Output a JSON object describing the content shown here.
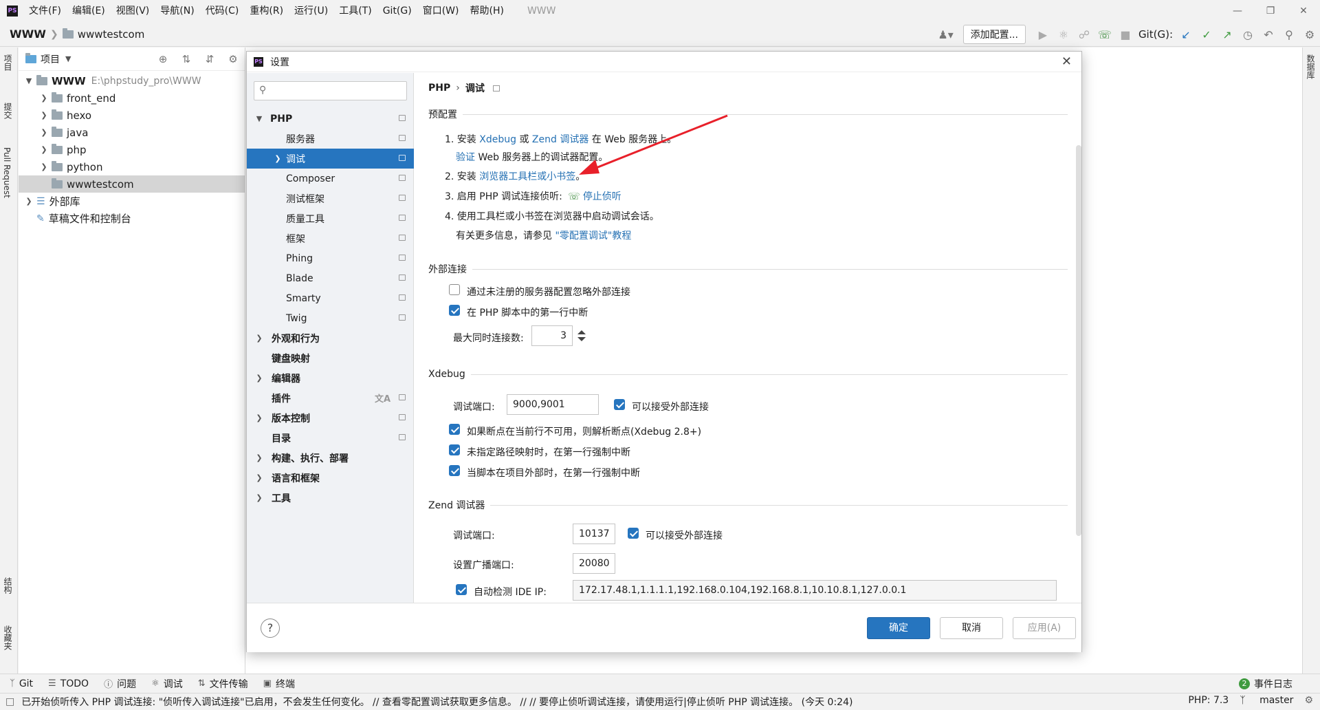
{
  "menubar": {
    "logo": "PS",
    "items": [
      "文件(F)",
      "编辑(E)",
      "视图(V)",
      "导航(N)",
      "代码(C)",
      "重构(R)",
      "运行(U)",
      "工具(T)",
      "Git(G)",
      "窗口(W)",
      "帮助(H)"
    ],
    "window_title": "WWW"
  },
  "navbar": {
    "root": "WWW",
    "leaf": "wwwtestcom",
    "add_config": "添加配置...",
    "git_label": "Git(G):"
  },
  "side_tabs": {
    "project": "项目",
    "commit": "提交",
    "pull_request": "Pull Request",
    "structure": "结构",
    "favorites": "收藏夹",
    "database": "数据库"
  },
  "project_panel": {
    "title": "项目",
    "root_name": "WWW",
    "root_path": "E:\\phpstudy_pro\\WWW",
    "folders": [
      "front_end",
      "hexo",
      "java",
      "php",
      "python",
      "wwwtestcom"
    ],
    "external_libs": "外部库",
    "scratches": "草稿文件和控制台"
  },
  "dialog": {
    "title": "设置",
    "nav": {
      "php": "PHP",
      "php_children": [
        "服务器",
        "调试",
        "Composer",
        "测试框架",
        "质量工具",
        "框架",
        "Phing",
        "Blade",
        "Smarty",
        "Twig"
      ],
      "sections": [
        "外观和行为",
        "键盘映射",
        "编辑器",
        "插件",
        "版本控制",
        "目录",
        "构建、执行、部署",
        "语言和框架",
        "工具"
      ]
    },
    "breadcrumb": {
      "parent": "PHP",
      "current": "调试"
    },
    "preconfig": {
      "header": "预配置",
      "step1_pre": "1. 安装 ",
      "step1_link1": "Xdebug",
      "step1_mid": " 或 ",
      "step1_link2": "Zend 调试器",
      "step1_post": " 在 Web 服务器上。",
      "verify_link": "验证",
      "verify_post": " Web 服务器上的调试器配置。",
      "step2_pre": "2. 安装 ",
      "step2_link": "浏览器工具栏或小书签",
      "step2_post": "。",
      "step3_pre": "3. 启用 PHP 调试连接侦听:",
      "step3_link": "停止侦听",
      "step4": "4. 使用工具栏或小书签在浏览器中启动调试会话。",
      "more_pre": "有关更多信息，请参见 ",
      "more_link": "\"零配置调试\"教程"
    },
    "external": {
      "header": "外部连接",
      "ignore_unregistered": "通过未注册的服务器配置忽略外部连接",
      "ignore_unregistered_checked": false,
      "break_first_line": "在 PHP 脚本中的第一行中断",
      "break_first_line_checked": true,
      "max_conn_label": "最大同时连接数:",
      "max_conn_value": "3"
    },
    "xdebug": {
      "header": "Xdebug",
      "port_label": "调试端口:",
      "port_value": "9000,9001",
      "accept_external": "可以接受外部连接",
      "accept_external_checked": true,
      "resolve_bp": "如果断点在当前行不可用，则解析断点(Xdebug 2.8+)",
      "resolve_bp_checked": true,
      "force_break_unmapped": "未指定路径映射时，在第一行强制中断",
      "force_break_unmapped_checked": true,
      "force_break_outside": "当脚本在项目外部时，在第一行强制中断",
      "force_break_outside_checked": true
    },
    "zend": {
      "header": "Zend 调试器",
      "port_label": "调试端口:",
      "port_value": "10137",
      "accept_external": "可以接受外部连接",
      "accept_external_checked": true,
      "broadcast_label": "设置广播端口:",
      "broadcast_value": "20080",
      "auto_ip_label": "自动检测 IDE IP:",
      "auto_ip_checked": true,
      "auto_ip_value": "172.17.48.1,1.1.1.1,192.168.0.104,192.168.8.1,10.10.8.1,127.0.0.1"
    },
    "footer": {
      "help": "?",
      "ok": "确定",
      "cancel": "取消",
      "apply": "应用(A)"
    }
  },
  "bottom_tools": {
    "items": [
      "Git",
      "TODO",
      "问题",
      "调试",
      "文件传输",
      "终端"
    ],
    "event_log_count": "2",
    "event_log": "事件日志"
  },
  "statusbar": {
    "message": "已开始侦听传入 PHP 调试连接: \"侦听传入调试连接\"已启用，不会发生任何变化。 // 查看零配置调试获取更多信息。 // // 要停止侦听调试连接，请使用运行|停止侦听 PHP 调试连接。 (今天 0:24)",
    "php_version": "PHP: 7.3",
    "branch": "master"
  },
  "colors": {
    "accent": "#2675bf",
    "link": "#2470b3",
    "annotation_arrow": "#e8202a"
  }
}
